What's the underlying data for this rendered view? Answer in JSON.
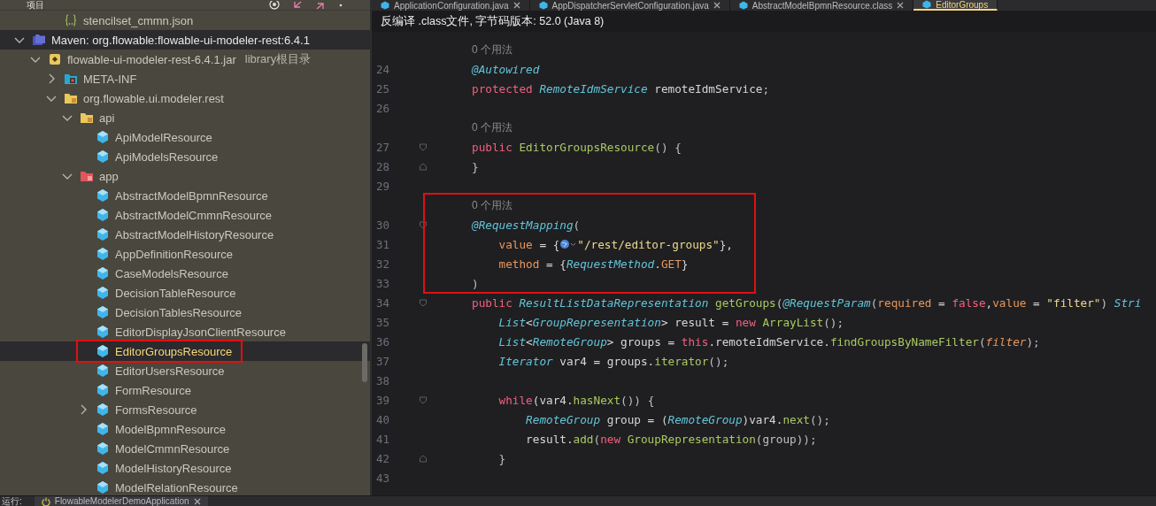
{
  "project_panel": {
    "title": "项目"
  },
  "tree_partial": [
    {
      "label": "stencilset_cmmn.json",
      "kind": "json",
      "selected": false,
      "current": false
    }
  ],
  "tree": [
    {
      "label": "Maven: org.flowable:flowable-ui-modeler-rest:6.4.1",
      "kind": "maven",
      "expanded": true,
      "selected": true,
      "current": false,
      "children": [
        {
          "label": "flowable-ui-modeler-rest-6.4.1.jar",
          "note": "library根目录",
          "kind": "jar",
          "expanded": true,
          "selected": false,
          "current": false,
          "children": [
            {
              "label": "META-INF",
              "kind": "meta",
              "expanded": false,
              "selected": false,
              "current": false
            },
            {
              "label": "org.flowable.ui.modeler.rest",
              "kind": "package",
              "expanded": true,
              "selected": false,
              "current": false,
              "children": [
                {
                  "label": "api",
                  "kind": "package",
                  "expanded": true,
                  "selected": false,
                  "current": false,
                  "children": [
                    {
                      "label": "ApiModelResource",
                      "kind": "class",
                      "selected": false,
                      "current": false
                    },
                    {
                      "label": "ApiModelsResource",
                      "kind": "class",
                      "selected": false,
                      "current": false
                    }
                  ]
                },
                {
                  "label": "app",
                  "kind": "app",
                  "expanded": true,
                  "selected": false,
                  "current": false,
                  "children": [
                    {
                      "label": "AbstractModelBpmnResource",
                      "kind": "class",
                      "selected": false,
                      "current": false
                    },
                    {
                      "label": "AbstractModelCmmnResource",
                      "kind": "class",
                      "selected": false,
                      "current": false
                    },
                    {
                      "label": "AbstractModelHistoryResource",
                      "kind": "class",
                      "selected": false,
                      "current": false
                    },
                    {
                      "label": "AppDefinitionResource",
                      "kind": "class",
                      "selected": false,
                      "current": false
                    },
                    {
                      "label": "CaseModelsResource",
                      "kind": "class",
                      "selected": false,
                      "current": false
                    },
                    {
                      "label": "DecisionTableResource",
                      "kind": "class",
                      "selected": false,
                      "current": false
                    },
                    {
                      "label": "DecisionTablesResource",
                      "kind": "class",
                      "selected": false,
                      "current": false
                    },
                    {
                      "label": "EditorDisplayJsonClientResource",
                      "kind": "class",
                      "selected": false,
                      "current": false
                    },
                    {
                      "label": "EditorGroupsResource",
                      "kind": "class",
                      "selected": true,
                      "current": true,
                      "boxed": true
                    },
                    {
                      "label": "EditorUsersResource",
                      "kind": "class",
                      "selected": false,
                      "current": false
                    },
                    {
                      "label": "FormResource",
                      "kind": "class",
                      "selected": false,
                      "current": false
                    },
                    {
                      "label": "FormsResource",
                      "kind": "class",
                      "expanded": false,
                      "selected": false,
                      "current": false
                    },
                    {
                      "label": "ModelBpmnResource",
                      "kind": "class",
                      "selected": false,
                      "current": false
                    },
                    {
                      "label": "ModelCmmnResource",
                      "kind": "class",
                      "selected": false,
                      "current": false
                    },
                    {
                      "label": "ModelHistoryResource",
                      "kind": "class",
                      "selected": false,
                      "current": false
                    },
                    {
                      "label": "ModelRelationResource",
                      "kind": "class",
                      "selected": false,
                      "current": false
                    }
                  ]
                }
              ]
            }
          ]
        }
      ]
    }
  ],
  "editor_tabs": [
    {
      "label": "ApplicationConfiguration.java",
      "selected": false,
      "closable": true
    },
    {
      "label": "AppDispatcherServletConfiguration.java",
      "selected": false,
      "closable": true
    },
    {
      "label": "AbstractModelBpmnResource.class",
      "selected": false,
      "closable": true
    },
    {
      "label": "EditorGroups",
      "selected": true,
      "closable": false
    }
  ],
  "info_bar": {
    "text": "反编译 .class文件, 字节码版本: 52.0 (Java 8)"
  },
  "code_lines": [
    {
      "kind": "hint",
      "text": "0 个用法"
    },
    {
      "number": "24",
      "tokens": [
        {
          "kind": "annotation",
          "text": "@Autowired"
        }
      ]
    },
    {
      "number": "25",
      "tokens": [
        {
          "kind": "keyword",
          "text": "protected "
        },
        {
          "kind": "type",
          "text": "RemoteIdmService"
        },
        {
          "kind": "plain",
          "text": " remoteIdmService"
        },
        {
          "kind": "punct",
          "text": ";"
        }
      ]
    },
    {
      "number": "26"
    },
    {
      "kind": "hint",
      "text": "0 个用法"
    },
    {
      "number": "27",
      "fold_open": true,
      "tokens": [
        {
          "kind": "keyword",
          "text": "public "
        },
        {
          "kind": "method",
          "text": "EditorGroupsResource"
        },
        {
          "kind": "punct",
          "text": "() {"
        }
      ]
    },
    {
      "number": "28",
      "fold_close": true,
      "tokens": [
        {
          "kind": "punct",
          "text": "}"
        }
      ]
    },
    {
      "number": "29"
    },
    {
      "kind": "hint",
      "text": "0 个用法",
      "boxed": true
    },
    {
      "number": "30",
      "fold_open": true,
      "boxed": true,
      "tokens": [
        {
          "kind": "annotation",
          "text": "@RequestMapping"
        },
        {
          "kind": "punct",
          "text": "("
        }
      ]
    },
    {
      "number": "31",
      "boxed": true,
      "tokens": [
        {
          "kind": "attr",
          "text": "    value"
        },
        {
          "kind": "plain",
          "text": " = {"
        },
        {
          "kind": "globe"
        },
        {
          "kind": "string",
          "text": "\"/rest/editor-groups\""
        },
        {
          "kind": "plain",
          "text": "},"
        }
      ]
    },
    {
      "number": "32",
      "boxed": true,
      "tokens": [
        {
          "kind": "attr",
          "text": "    method"
        },
        {
          "kind": "plain",
          "text": " = {"
        },
        {
          "kind": "type",
          "text": "RequestMethod"
        },
        {
          "kind": "plain",
          "text": "."
        },
        {
          "kind": "field",
          "text": "GET"
        },
        {
          "kind": "plain",
          "text": "}"
        }
      ]
    },
    {
      "number": "33",
      "boxed": true,
      "tokens": [
        {
          "kind": "punct",
          "text": ")"
        }
      ]
    },
    {
      "number": "34",
      "fold_open": true,
      "tokens": [
        {
          "kind": "keyword",
          "text": "public "
        },
        {
          "kind": "type",
          "text": "ResultListDataRepresentation"
        },
        {
          "kind": "method",
          "text": " getGroups"
        },
        {
          "kind": "punct",
          "text": "("
        },
        {
          "kind": "annotation",
          "text": "@RequestParam"
        },
        {
          "kind": "punct",
          "text": "("
        },
        {
          "kind": "attr",
          "text": "required"
        },
        {
          "kind": "plain",
          "text": " = "
        },
        {
          "kind": "keyword",
          "text": "false"
        },
        {
          "kind": "plain",
          "text": ","
        },
        {
          "kind": "attr",
          "text": "value"
        },
        {
          "kind": "plain",
          "text": " = "
        },
        {
          "kind": "string",
          "text": "\"filter\""
        },
        {
          "kind": "punct",
          "text": ") "
        },
        {
          "kind": "type",
          "text": "Stri"
        }
      ]
    },
    {
      "number": "35",
      "tokens": [
        {
          "kind": "type",
          "text": "    List"
        },
        {
          "kind": "plain",
          "text": "<"
        },
        {
          "kind": "type",
          "text": "GroupRepresentation"
        },
        {
          "kind": "plain",
          "text": "> result = "
        },
        {
          "kind": "keyword",
          "text": "new "
        },
        {
          "kind": "method",
          "text": "ArrayList"
        },
        {
          "kind": "punct",
          "text": "();"
        }
      ]
    },
    {
      "number": "36",
      "tokens": [
        {
          "kind": "type",
          "text": "    List"
        },
        {
          "kind": "plain",
          "text": "<"
        },
        {
          "kind": "type",
          "text": "RemoteGroup"
        },
        {
          "kind": "plain",
          "text": "> groups = "
        },
        {
          "kind": "keyword",
          "text": "this"
        },
        {
          "kind": "plain",
          "text": ".remoteIdmService."
        },
        {
          "kind": "method",
          "text": "findGroupsByNameFilter"
        },
        {
          "kind": "punct",
          "text": "("
        },
        {
          "kind": "param",
          "text": "filter"
        },
        {
          "kind": "punct",
          "text": ");"
        }
      ]
    },
    {
      "number": "37",
      "tokens": [
        {
          "kind": "type",
          "text": "    Iterator"
        },
        {
          "kind": "plain",
          "text": " var4 = groups."
        },
        {
          "kind": "method",
          "text": "iterator"
        },
        {
          "kind": "punct",
          "text": "();"
        }
      ]
    },
    {
      "number": "38"
    },
    {
      "number": "39",
      "fold_open": true,
      "tokens": [
        {
          "kind": "keyword",
          "text": "    while"
        },
        {
          "kind": "plain",
          "text": "(var4."
        },
        {
          "kind": "method",
          "text": "hasNext"
        },
        {
          "kind": "punct",
          "text": "()) {"
        }
      ]
    },
    {
      "number": "40",
      "tokens": [
        {
          "kind": "type",
          "text": "        RemoteGroup"
        },
        {
          "kind": "plain",
          "text": " group = ("
        },
        {
          "kind": "type",
          "text": "RemoteGroup"
        },
        {
          "kind": "plain",
          "text": ")var4."
        },
        {
          "kind": "method",
          "text": "next"
        },
        {
          "kind": "punct",
          "text": "();"
        }
      ]
    },
    {
      "number": "41",
      "tokens": [
        {
          "kind": "plain",
          "text": "        result."
        },
        {
          "kind": "method",
          "text": "add"
        },
        {
          "kind": "punct",
          "text": "("
        },
        {
          "kind": "keyword",
          "text": "new "
        },
        {
          "kind": "method",
          "text": "GroupRepresentation"
        },
        {
          "kind": "punct",
          "text": "(group));"
        }
      ]
    },
    {
      "number": "42",
      "fold_close": true,
      "tokens": [
        {
          "kind": "punct",
          "text": "    }"
        }
      ]
    },
    {
      "number": "43"
    }
  ],
  "run_bar": {
    "label": "运行:",
    "tabs": [
      {
        "label": "FlowableModelerDemoApplication",
        "selected": true
      }
    ]
  }
}
